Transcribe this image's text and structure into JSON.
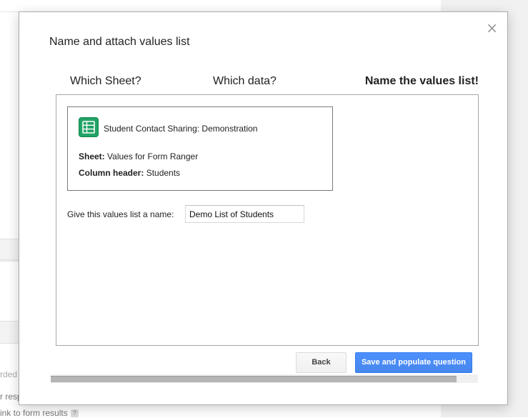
{
  "background": {
    "truncated_lines": [
      "rded",
      "r resp",
      "ink to form results"
    ],
    "help_glyph": "?"
  },
  "dialog": {
    "title": "Name and attach values list",
    "close_glyph": "×",
    "steps": [
      "Which Sheet?",
      "Which data?",
      "Name the values list!"
    ],
    "active_step": 3,
    "summary": {
      "icon": "spreadsheet-icon",
      "icon_color": "#21a366",
      "sheet_name": "Student Contact Sharing: Demonstration",
      "sheet_label": "Sheet:",
      "sheet_value": "Values for Form Ranger",
      "column_label": "Column header:",
      "column_value": "Students"
    },
    "name_field": {
      "label": "Give this values list a name:",
      "value": "Demo List of Students"
    },
    "buttons": {
      "back_label": "Back",
      "save_label": "Save and populate question",
      "save_color": "#4d90fe"
    }
  }
}
